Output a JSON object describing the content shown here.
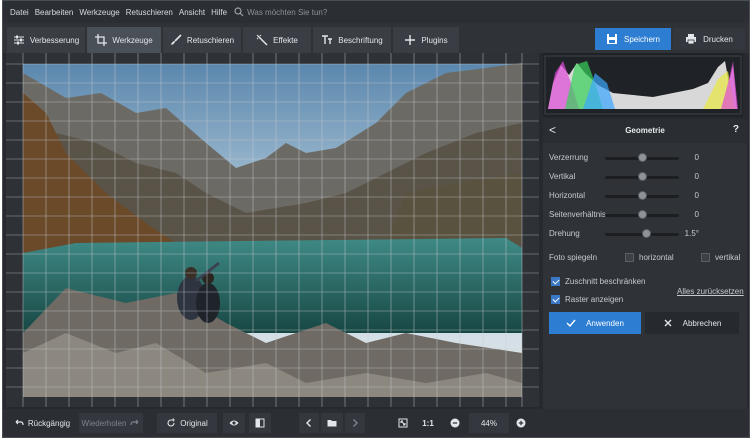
{
  "menu": [
    "Datei",
    "Bearbeiten",
    "Werkzeuge",
    "Retuschieren",
    "Ansicht",
    "Hilfe"
  ],
  "search": {
    "placeholder": "Was möchten Sie tun?",
    "icon": "search-icon"
  },
  "tabs": [
    {
      "label": "Verbesserung",
      "icon": "sliders-icon"
    },
    {
      "label": "Werkzeuge",
      "icon": "crop-icon",
      "active": true
    },
    {
      "label": "Retuschieren",
      "icon": "brush-icon"
    },
    {
      "label": "Effekte",
      "icon": "wand-icon"
    },
    {
      "label": "Beschriftung",
      "icon": "text-icon"
    },
    {
      "label": "Plugins",
      "icon": "plus-icon"
    }
  ],
  "toolbar": {
    "save_label": "Speichern",
    "print_label": "Drucken"
  },
  "panel": {
    "title": "Geometrie",
    "back": "<",
    "help": "?",
    "sliders": [
      {
        "label": "Verzerrung",
        "value": "0",
        "position": 0.5
      },
      {
        "label": "Vertikal",
        "value": "0",
        "position": 0.5
      },
      {
        "label": "Horizontal",
        "value": "0",
        "position": 0.5
      },
      {
        "label": "Seitenverhältnis",
        "value": "0",
        "position": 0.5
      },
      {
        "label": "Drehung",
        "value": "1.5°",
        "position": 0.55
      }
    ],
    "mirror": {
      "label": "Foto spiegeln",
      "horizontal": "horizontal",
      "vertical": "vertikal"
    },
    "options": [
      {
        "label": "Zuschnitt beschränken",
        "checked": true
      },
      {
        "label": "Raster anzeigen",
        "checked": true
      }
    ],
    "reset": "Alles zurücksetzen",
    "apply": "Anwenden",
    "cancel": "Abbrechen"
  },
  "bottom": {
    "undo": "Rückgängig",
    "redo": "Wiederholen",
    "original": "Original",
    "zoom_fit": "1:1",
    "zoom": "44%"
  },
  "colors": {
    "accent": "#2d7dd2",
    "bg": "#26292e",
    "panel": "#2f3237"
  }
}
